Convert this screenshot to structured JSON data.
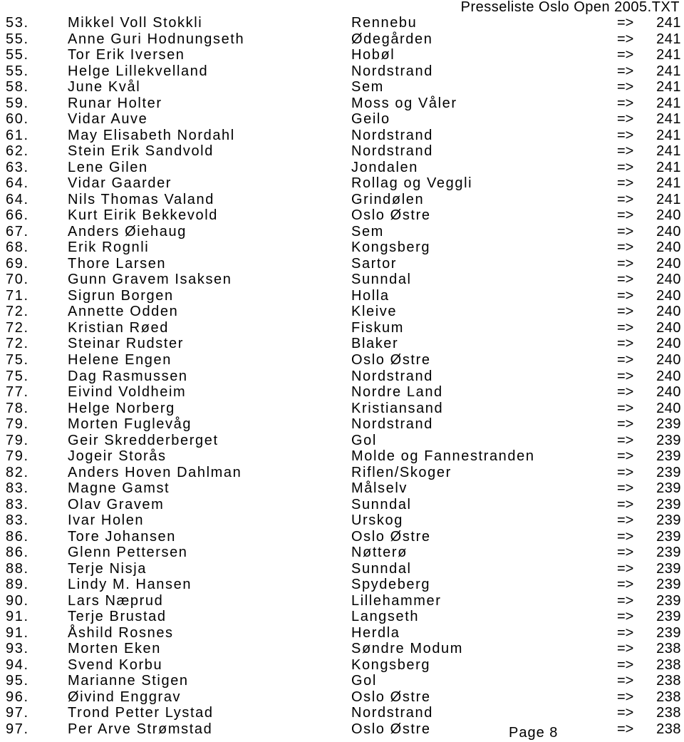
{
  "header": {
    "title": "Presseliste Oslo Open 2005.TXT"
  },
  "arrow": "=>",
  "rows": [
    {
      "rank": "53.",
      "name": "Mikkel Voll Stokkli",
      "club": "Rennebu",
      "score": "241"
    },
    {
      "rank": "55.",
      "name": "Anne Guri Hodnungseth",
      "club": "Ødegården",
      "score": "241"
    },
    {
      "rank": "55.",
      "name": "Tor Erik Iversen",
      "club": "Hobøl",
      "score": "241"
    },
    {
      "rank": "55.",
      "name": "Helge Lillekvelland",
      "club": "Nordstrand",
      "score": "241"
    },
    {
      "rank": "58.",
      "name": "June Kvål",
      "club": "Sem",
      "score": "241"
    },
    {
      "rank": "59.",
      "name": "Runar Holter",
      "club": "Moss og Våler",
      "score": "241"
    },
    {
      "rank": "60.",
      "name": "Vidar Auve",
      "club": "Geilo",
      "score": "241"
    },
    {
      "rank": "61.",
      "name": "May Elisabeth Nordahl",
      "club": "Nordstrand",
      "score": "241"
    },
    {
      "rank": "62.",
      "name": "Stein Erik Sandvold",
      "club": "Nordstrand",
      "score": "241"
    },
    {
      "rank": "63.",
      "name": "Lene Gilen",
      "club": "Jondalen",
      "score": "241"
    },
    {
      "rank": "64.",
      "name": "Vidar Gaarder",
      "club": "Rollag og Veggli",
      "score": "241"
    },
    {
      "rank": "64.",
      "name": "Nils Thomas Valand",
      "club": "Grindølen",
      "score": "241"
    },
    {
      "rank": "66.",
      "name": "Kurt Eirik Bekkevold",
      "club": "Oslo Østre",
      "score": "240"
    },
    {
      "rank": "67.",
      "name": "Anders Øiehaug",
      "club": "Sem",
      "score": "240"
    },
    {
      "rank": "68.",
      "name": "Erik Rognli",
      "club": "Kongsberg",
      "score": "240"
    },
    {
      "rank": "69.",
      "name": "Thore Larsen",
      "club": "Sartor",
      "score": "240"
    },
    {
      "rank": "70.",
      "name": "Gunn Gravem Isaksen",
      "club": "Sunndal",
      "score": "240"
    },
    {
      "rank": "71.",
      "name": "Sigrun Borgen",
      "club": "Holla",
      "score": "240"
    },
    {
      "rank": "72.",
      "name": "Annette Odden",
      "club": "Kleive",
      "score": "240"
    },
    {
      "rank": "72.",
      "name": "Kristian Røed",
      "club": "Fiskum",
      "score": "240"
    },
    {
      "rank": "72.",
      "name": "Steinar Rudster",
      "club": "Blaker",
      "score": "240"
    },
    {
      "rank": "75.",
      "name": "Helene Engen",
      "club": "Oslo Østre",
      "score": "240"
    },
    {
      "rank": "75.",
      "name": "Dag Rasmussen",
      "club": "Nordstrand",
      "score": "240"
    },
    {
      "rank": "77.",
      "name": "Eivind Voldheim",
      "club": "Nordre Land",
      "score": "240"
    },
    {
      "rank": "78.",
      "name": "Helge Norberg",
      "club": "Kristiansand",
      "score": "240"
    },
    {
      "rank": "79.",
      "name": "Morten Fuglevåg",
      "club": "Nordstrand",
      "score": "239"
    },
    {
      "rank": "79.",
      "name": "Geir Skredderberget",
      "club": "Gol",
      "score": "239"
    },
    {
      "rank": "79.",
      "name": "Jogeir Storås",
      "club": "Molde og Fannestranden",
      "score": "239"
    },
    {
      "rank": "82.",
      "name": "Anders Hoven Dahlman",
      "club": "Riflen/Skoger",
      "score": "239"
    },
    {
      "rank": "83.",
      "name": "Magne Gamst",
      "club": "Målselv",
      "score": "239"
    },
    {
      "rank": "83.",
      "name": "Olav Gravem",
      "club": "Sunndal",
      "score": "239"
    },
    {
      "rank": "83.",
      "name": "Ivar Holen",
      "club": "Urskog",
      "score": "239"
    },
    {
      "rank": "86.",
      "name": "Tore Johansen",
      "club": "Oslo Østre",
      "score": "239"
    },
    {
      "rank": "86.",
      "name": "Glenn Pettersen",
      "club": "Nøtterø",
      "score": "239"
    },
    {
      "rank": "88.",
      "name": "Terje Nisja",
      "club": "Sunndal",
      "score": "239"
    },
    {
      "rank": "89.",
      "name": "Lindy M. Hansen",
      "club": "Spydeberg",
      "score": "239"
    },
    {
      "rank": "90.",
      "name": "Lars Næprud",
      "club": "Lillehammer",
      "score": "239"
    },
    {
      "rank": "91.",
      "name": "Terje Brustad",
      "club": "Langseth",
      "score": "239"
    },
    {
      "rank": "91.",
      "name": "Åshild Rosnes",
      "club": "Herdla",
      "score": "239"
    },
    {
      "rank": "93.",
      "name": "Morten Eken",
      "club": "Søndre Modum",
      "score": "238"
    },
    {
      "rank": "94.",
      "name": "Svend Korbu",
      "club": "Kongsberg",
      "score": "238"
    },
    {
      "rank": "95.",
      "name": "Marianne Stigen",
      "club": "Gol",
      "score": "238"
    },
    {
      "rank": "96.",
      "name": "Øivind Enggrav",
      "club": "Oslo Østre",
      "score": "238"
    },
    {
      "rank": "97.",
      "name": "Trond Petter Lystad",
      "club": "Nordstrand",
      "score": "238"
    },
    {
      "rank": "97.",
      "name": "Per Arve Strømstad",
      "club": "Oslo Østre",
      "score": "238"
    }
  ],
  "footer": {
    "page": "Page 8"
  }
}
